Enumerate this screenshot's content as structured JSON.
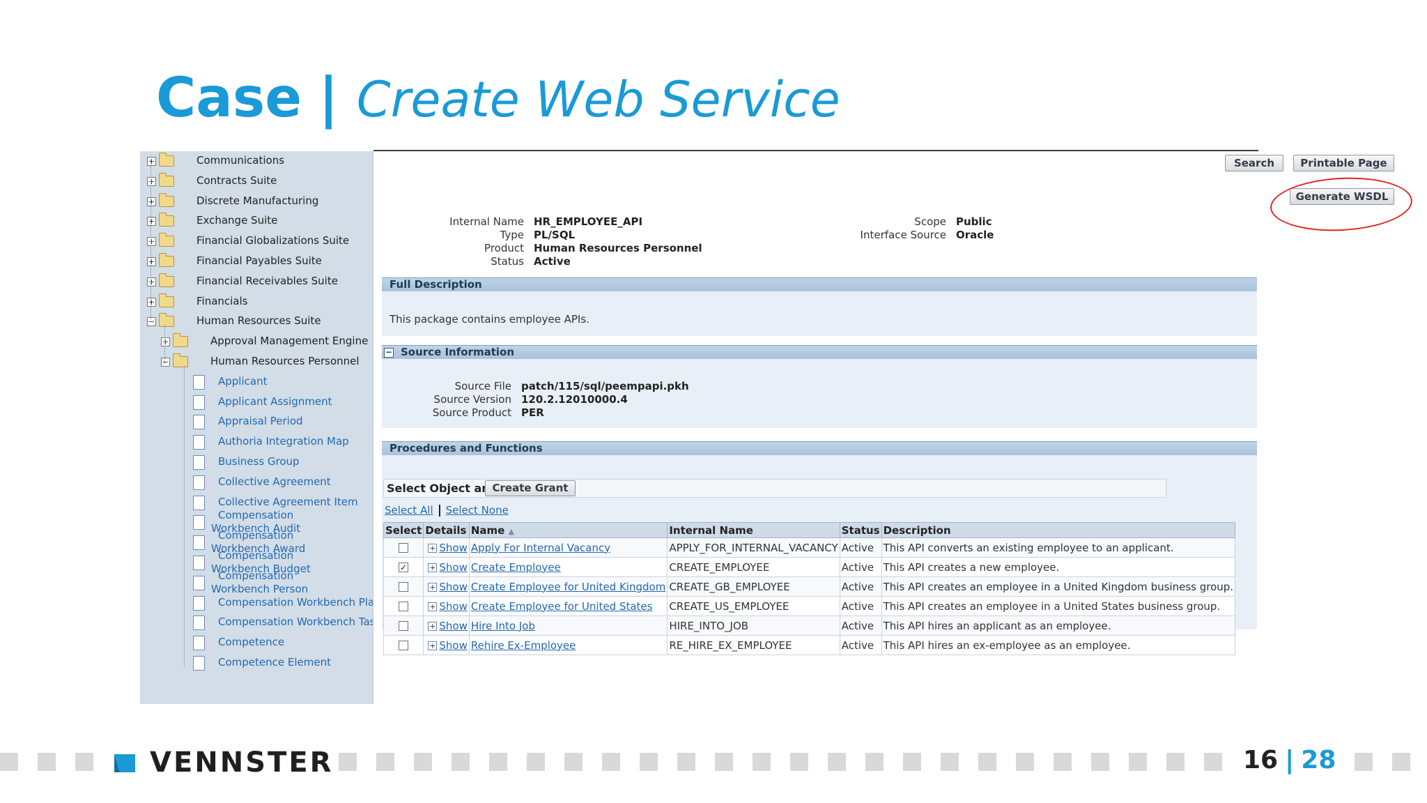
{
  "slide": {
    "title_bold": "Case",
    "title_sep": "|",
    "title_italic": "Create Web Service"
  },
  "tree": {
    "items": [
      {
        "label": "Communications",
        "type": "folder",
        "level": 0
      },
      {
        "label": "Contracts Suite",
        "type": "folder",
        "level": 0
      },
      {
        "label": "Discrete Manufacturing",
        "type": "folder",
        "level": 0
      },
      {
        "label": "Exchange Suite",
        "type": "folder",
        "level": 0
      },
      {
        "label": "Financial Globalizations Suite",
        "type": "folder",
        "level": 0
      },
      {
        "label": "Financial Payables Suite",
        "type": "folder",
        "level": 0
      },
      {
        "label": "Financial Receivables Suite",
        "type": "folder",
        "level": 0
      },
      {
        "label": "Financials",
        "type": "folder",
        "level": 0
      },
      {
        "label": "Human Resources Suite",
        "type": "folder",
        "level": 0,
        "expanded": true
      },
      {
        "label": "Approval Management Engine",
        "type": "folder",
        "level": 1
      },
      {
        "label": "Human Resources Personnel",
        "type": "folder",
        "level": 1,
        "expanded": true
      },
      {
        "label": "Applicant",
        "type": "doc",
        "level": 2
      },
      {
        "label": "Applicant Assignment",
        "type": "doc",
        "level": 2
      },
      {
        "label": "Appraisal Period",
        "type": "doc",
        "level": 2
      },
      {
        "label": "Authoria Integration Map",
        "type": "doc",
        "level": 2
      },
      {
        "label": "Business Group",
        "type": "doc",
        "level": 2
      },
      {
        "label": "Collective Agreement",
        "type": "doc",
        "level": 2
      },
      {
        "label": "Collective Agreement Item",
        "type": "doc",
        "level": 2
      },
      {
        "label": "Compensation Workbench Audit",
        "type": "doc",
        "level": 2
      },
      {
        "label": "Compensation Workbench Award",
        "type": "doc",
        "level": 2
      },
      {
        "label": "Compensation Workbench Budget",
        "type": "doc",
        "level": 2
      },
      {
        "label": "Compensation Workbench Person",
        "type": "doc",
        "level": 2
      },
      {
        "label": "Compensation Workbench Plan",
        "type": "doc",
        "level": 2
      },
      {
        "label": "Compensation Workbench Task",
        "type": "doc",
        "level": 2
      },
      {
        "label": "Competence",
        "type": "doc",
        "level": 2
      },
      {
        "label": "Competence Element",
        "type": "doc",
        "level": 2
      }
    ]
  },
  "toolbar": {
    "search_label": "Search",
    "printable_label": "Printable Page",
    "generate_wsdl_label": "Generate WSDL"
  },
  "details": {
    "internal_name_label": "Internal Name",
    "internal_name": "HR_EMPLOYEE_API",
    "type_label": "Type",
    "type": "PL/SQL",
    "product_label": "Product",
    "product": "Human Resources Personnel",
    "status_label": "Status",
    "status": "Active",
    "scope_label": "Scope",
    "scope": "Public",
    "interface_source_label": "Interface Source",
    "interface_source": "Oracle"
  },
  "full_description": {
    "title": "Full Description",
    "text": "This package contains employee APIs."
  },
  "source_info": {
    "title": "Source Information",
    "toggle": "−",
    "source_file_label": "Source File",
    "source_file": "patch/115/sql/peempapi.pkh",
    "source_version_label": "Source Version",
    "source_version": "120.2.12010000.4",
    "source_product_label": "Source Product",
    "source_product": "PER"
  },
  "procedures": {
    "title": "Procedures and Functions",
    "select_object_label": "Select Object and",
    "create_grant_label": "Create Grant",
    "select_all": "Select All",
    "select_none": "Select None",
    "headers": {
      "select": "Select",
      "details": "Details",
      "name": "Name",
      "internal_name": "Internal Name",
      "status": "Status",
      "description": "Description"
    },
    "show_label": "Show",
    "rows": [
      {
        "checked": false,
        "name": "Apply For Internal Vacancy",
        "internal_name": "APPLY_FOR_INTERNAL_VACANCY",
        "status": "Active",
        "description": "This API converts an existing employee to an applicant."
      },
      {
        "checked": true,
        "name": "Create Employee",
        "internal_name": "CREATE_EMPLOYEE",
        "status": "Active",
        "description": "This API creates a new employee."
      },
      {
        "checked": false,
        "name": "Create Employee for United Kingdom",
        "internal_name": "CREATE_GB_EMPLOYEE",
        "status": "Active",
        "description": "This API creates an employee in a United Kingdom business group."
      },
      {
        "checked": false,
        "name": "Create Employee for United States",
        "internal_name": "CREATE_US_EMPLOYEE",
        "status": "Active",
        "description": "This API creates an employee in a United States business group."
      },
      {
        "checked": false,
        "name": "Hire Into Job",
        "internal_name": "HIRE_INTO_JOB",
        "status": "Active",
        "description": "This API hires an applicant as an employee."
      },
      {
        "checked": false,
        "name": "Rehire Ex-Employee",
        "internal_name": "RE_HIRE_EX_EMPLOYEE",
        "status": "Active",
        "description": "This API hires an ex-employee as an employee."
      }
    ]
  },
  "footer": {
    "brand": "VENNSTER",
    "page_current": "16",
    "page_sep": "|",
    "page_total": "28",
    "accent_color": "#1a9ad6"
  }
}
